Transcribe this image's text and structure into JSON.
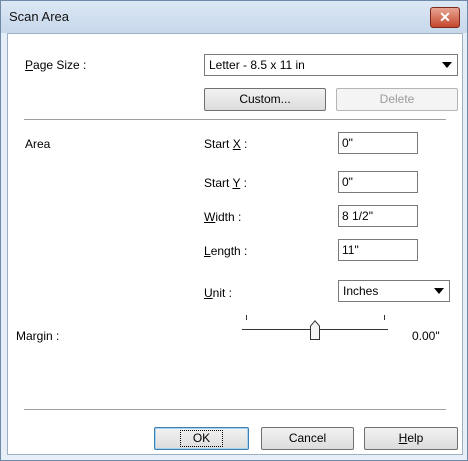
{
  "window": {
    "title": "Scan Area",
    "close_glyph": "✕"
  },
  "page_size": {
    "label_pre": "",
    "label_u": "P",
    "label_post": "age Size :",
    "value": "Letter - 8.5 x 11 in"
  },
  "buttons": {
    "custom": "Custom...",
    "delete": "Delete",
    "ok": "OK",
    "cancel": "Cancel",
    "help_u": "H",
    "help_post": "elp"
  },
  "area": {
    "label": "Area",
    "start_x": {
      "pre": "Start ",
      "u": "X",
      "post": " :",
      "value": "0\""
    },
    "start_y": {
      "pre": "Start ",
      "u": "Y",
      "post": " :",
      "value": "0\""
    },
    "width": {
      "pre": "",
      "u": "W",
      "post": "idth :",
      "value": "8 1/2\""
    },
    "length": {
      "pre": "",
      "u": "L",
      "post": "ength :",
      "value": "11\""
    },
    "unit": {
      "pre": "",
      "u": "U",
      "post": "nit :",
      "value": "Inches"
    }
  },
  "margin": {
    "pre": "Mar",
    "u": "g",
    "post": "in :",
    "value": "0.00\"",
    "fraction": 0.5
  }
}
